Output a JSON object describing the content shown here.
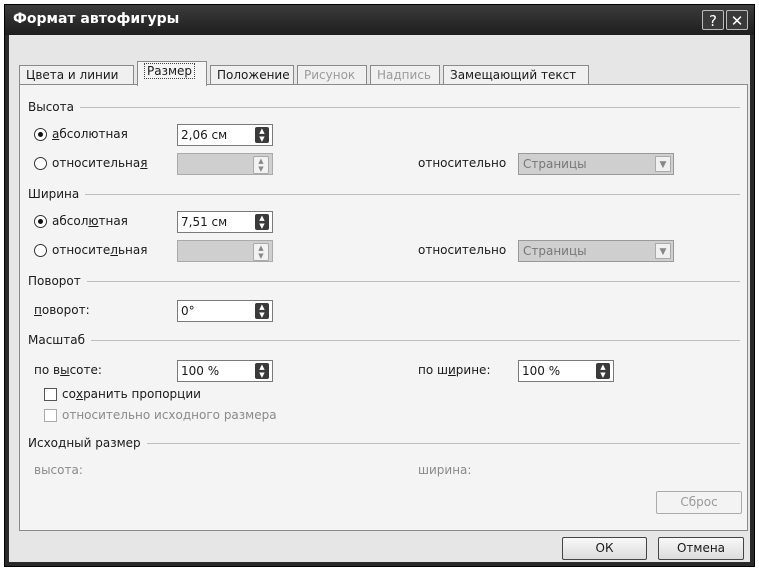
{
  "window": {
    "title": "Формат автофигуры",
    "help_label": "?",
    "close_label": "✕"
  },
  "tabs": [
    {
      "label": "Цвета и линии",
      "state": "normal"
    },
    {
      "label": "Размер",
      "state": "active"
    },
    {
      "label": "Положение",
      "state": "normal"
    },
    {
      "label": "Рисунок",
      "state": "disabled"
    },
    {
      "label": "Надпись",
      "state": "disabled"
    },
    {
      "label": "Замещающий текст",
      "state": "normal"
    }
  ],
  "height": {
    "group_label": "Высота",
    "absolute": {
      "label_pre": "",
      "label_u": "а",
      "label_post": "бсолютная",
      "value": "2,06 см",
      "selected": true
    },
    "relative": {
      "label_pre": "относительна",
      "label_u": "я",
      "label_post": "",
      "value": "",
      "selected": false
    },
    "relative_to_label": "относительно",
    "relative_to_value": "Страницы"
  },
  "width": {
    "group_label": "Ширина",
    "absolute": {
      "label_pre": "абсол",
      "label_u": "ю",
      "label_post": "тная",
      "value": "7,51 см",
      "selected": true
    },
    "relative": {
      "label_pre": "относите",
      "label_u": "л",
      "label_post": "ьная",
      "value": "",
      "selected": false
    },
    "relative_to_label": "относительно",
    "relative_to_value": "Страницы"
  },
  "rotation": {
    "group_label": "Поворот",
    "label_pre": "",
    "label_u": "п",
    "label_post": "оворот:",
    "value": "0°"
  },
  "scale": {
    "group_label": "Масштаб",
    "height_label_pre": "по в",
    "height_label_u": "ы",
    "height_label_post": "соте:",
    "height_value": "100 %",
    "width_label_pre": "по ш",
    "width_label_u": "и",
    "width_label_post": "рине:",
    "width_value": "100 %",
    "lock_label_pre": "со",
    "lock_label_u": "х",
    "lock_label_post": "ранить пропорции",
    "lock_checked": false,
    "relative_original_label": "относительно исходного размера",
    "relative_original_checked": false
  },
  "original": {
    "group_label": "Исходный размер",
    "height_label": "высота:",
    "width_label": "ширина:",
    "reset_label": "Сброс"
  },
  "footer": {
    "ok_label": "ОК",
    "cancel_label": "Отмена"
  }
}
